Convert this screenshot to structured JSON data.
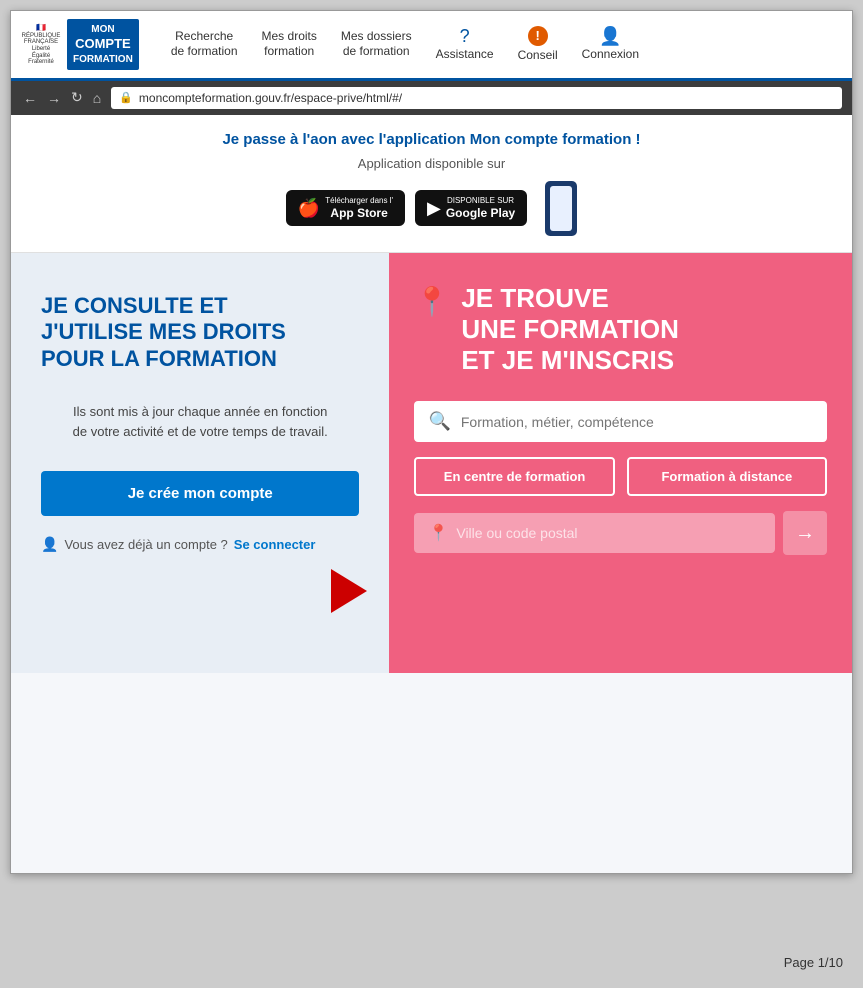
{
  "nav": {
    "links": [
      {
        "id": "recherche",
        "label": "Recherche\nde formation",
        "line1": "Recherche",
        "line2": "de formation"
      },
      {
        "id": "droits",
        "label": "Mes droits\nformation",
        "line1": "Mes droits",
        "line2": "formation"
      },
      {
        "id": "dossiers",
        "label": "Mes dossiers\nde formation",
        "line1": "Mes dossiers",
        "line2": "de formation"
      },
      {
        "id": "assistance",
        "label": "Assistance",
        "icon": "?"
      },
      {
        "id": "conseil",
        "label": "Conseil",
        "icon": "!"
      },
      {
        "id": "connexion",
        "label": "Connexion",
        "icon": "👤"
      }
    ]
  },
  "address_bar": {
    "url": "moncompteformation.gouv.fr/espace-prive/html/#/"
  },
  "app_banner": {
    "title": "Je passe à l'aon avec l'application Mon compte formation !",
    "subtitle": "Application disponible sur",
    "store1_small": "Télécharger dans l'",
    "store1_name": "App Store",
    "store2_small": "DISPONIBLE SUR",
    "store2_name": "Google Play"
  },
  "left_panel": {
    "title": "JE CONSULTE ET\nJ'UTILISE MES DROITS\nPOUR LA FORMATION",
    "description": "Ils sont mis à jour chaque année en fonction\nde votre activité et de votre temps de travail.",
    "create_btn": "Je crée mon compte",
    "login_text": "Vous avez déjà un compte ?",
    "login_link": "Se connecter"
  },
  "right_panel": {
    "title": "JE TROUVE\nUNE FORMATION\nET JE M'INSCRIS",
    "search_placeholder": "Formation, métier, compétence",
    "filter1": "En centre de formation",
    "filter2": "Formation à distance",
    "location_placeholder": "Ville ou code postal",
    "go_btn": "→"
  },
  "page_number": "Page 1/10"
}
